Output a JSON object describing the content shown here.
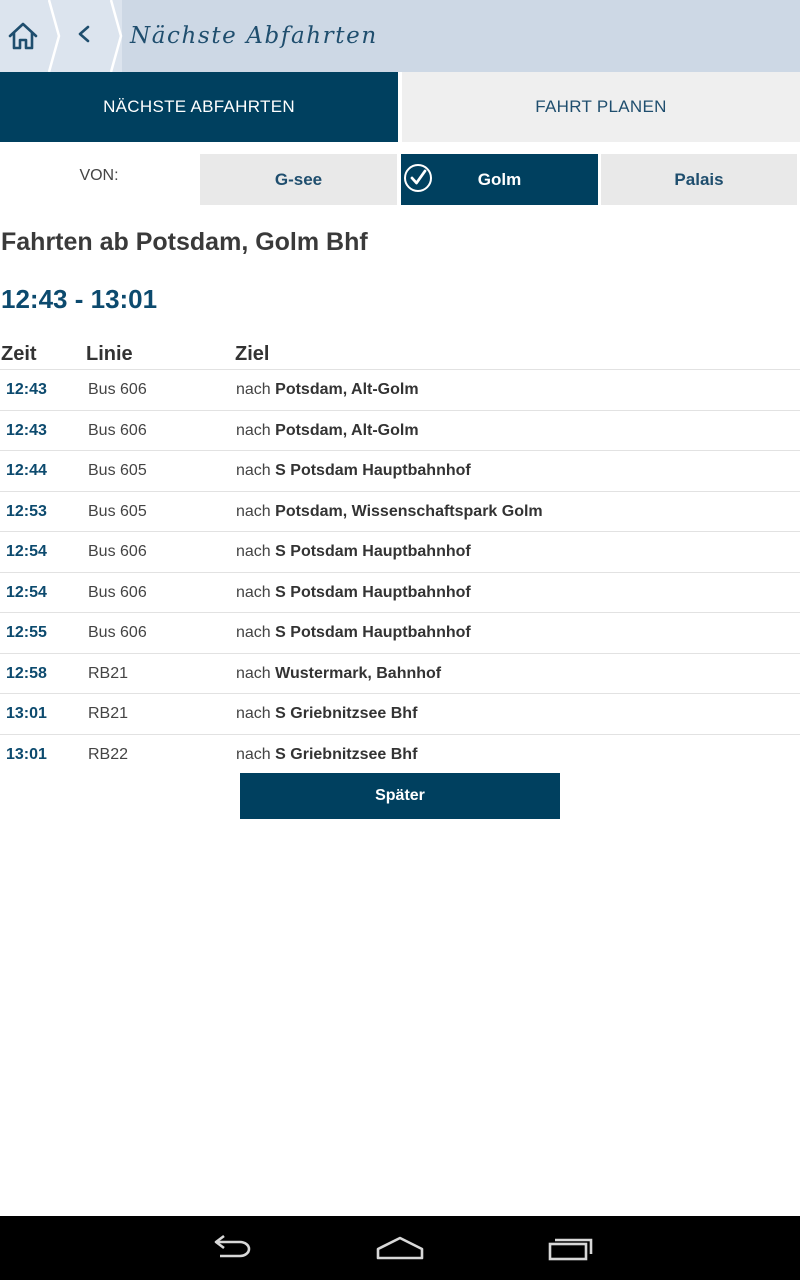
{
  "actionbar": {
    "title": "Nächste Abfahrten",
    "home_icon": "home-icon",
    "back_icon": "chevron-left-icon"
  },
  "tabs": [
    {
      "label": "NÄCHSTE ABFAHRTEN",
      "active": true
    },
    {
      "label": "FAHRT PLANEN",
      "active": false
    }
  ],
  "station_selector": {
    "label": "VON:",
    "options": [
      {
        "label": "G-see",
        "selected": false
      },
      {
        "label": "Golm",
        "selected": true
      },
      {
        "label": "Palais",
        "selected": false
      }
    ],
    "selected_icon": "checkmark-circle-icon"
  },
  "heading": "Fahrten ab Potsdam, Golm Bhf",
  "time_range": "12:43 - 13:01",
  "table": {
    "headers": {
      "time": "Zeit",
      "line": "Linie",
      "destination": "Ziel"
    },
    "prefix": "nach",
    "rows": [
      {
        "time": "12:43",
        "line": "Bus 606",
        "destination": "Potsdam, Alt-Golm"
      },
      {
        "time": "12:43",
        "line": "Bus 606",
        "destination": "Potsdam, Alt-Golm"
      },
      {
        "time": "12:44",
        "line": "Bus 605",
        "destination": "S Potsdam Hauptbahnhof"
      },
      {
        "time": "12:53",
        "line": "Bus 605",
        "destination": "Potsdam, Wissenschaftspark Golm"
      },
      {
        "time": "12:54",
        "line": "Bus 606",
        "destination": "S Potsdam Hauptbahnhof"
      },
      {
        "time": "12:54",
        "line": "Bus 606",
        "destination": "S Potsdam Hauptbahnhof"
      },
      {
        "time": "12:55",
        "line": "Bus 606",
        "destination": "S Potsdam Hauptbahnhof"
      },
      {
        "time": "12:58",
        "line": "RB21",
        "destination": "Wustermark, Bahnhof"
      },
      {
        "time": "13:01",
        "line": "RB21",
        "destination": "S Griebnitzsee Bhf"
      },
      {
        "time": "13:01",
        "line": "RB22",
        "destination": "S Griebnitzsee Bhf"
      }
    ]
  },
  "later_button": "Später",
  "navbar": {
    "icons": [
      "back-arrow-icon",
      "home-outline-icon",
      "recent-apps-icon"
    ]
  },
  "colors": {
    "primary": "#00405f",
    "actionbar": "#cdd8e5",
    "accent_text": "#0c4a6e"
  }
}
